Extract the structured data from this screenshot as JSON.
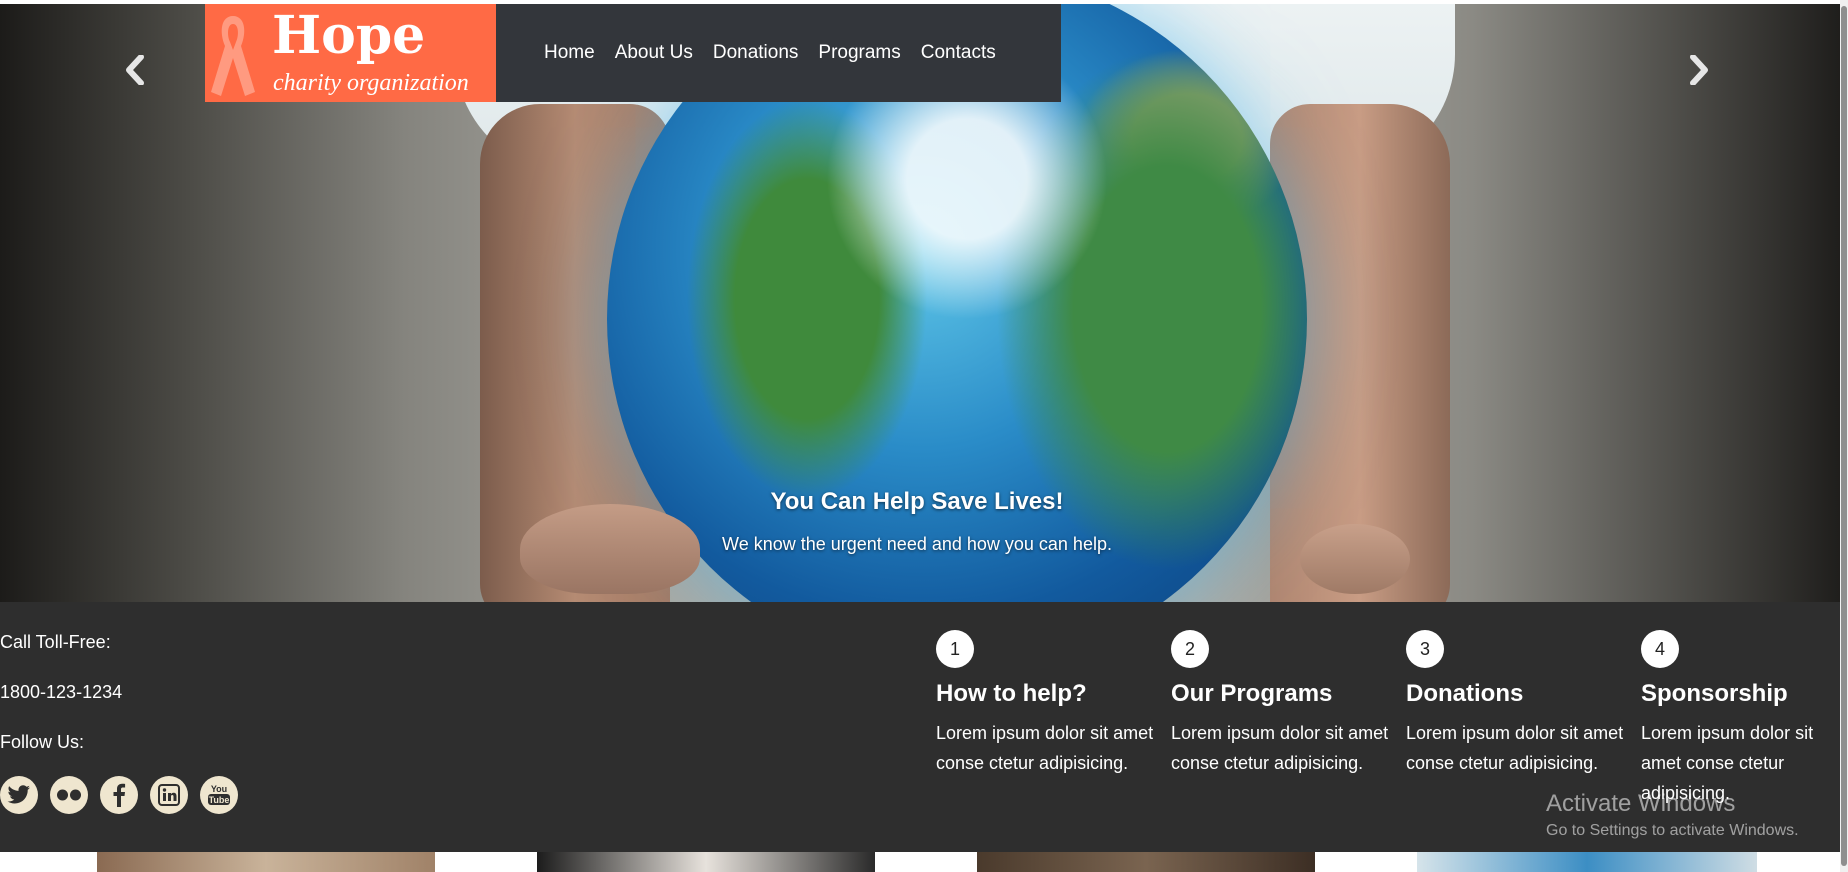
{
  "brand": {
    "name": "Hope",
    "tagline": "charity organization",
    "color": "#ff6a45"
  },
  "nav": {
    "items": [
      {
        "label": "Home"
      },
      {
        "label": "About Us"
      },
      {
        "label": "Donations"
      },
      {
        "label": "Programs"
      },
      {
        "label": "Contacts"
      }
    ]
  },
  "hero": {
    "title": "You Can Help Save Lives!",
    "subtitle": "We know the urgent need and how you can help.",
    "prev_icon": "chevron-left",
    "next_icon": "chevron-right"
  },
  "contact": {
    "toll_free_label": "Call Toll-Free:",
    "phone": "1800-123-1234",
    "follow_label": "Follow Us:",
    "social": [
      {
        "name": "twitter-icon"
      },
      {
        "name": "flickr-icon"
      },
      {
        "name": "facebook-icon"
      },
      {
        "name": "linkedin-icon"
      },
      {
        "name": "youtube-icon"
      }
    ]
  },
  "features": [
    {
      "num": "1",
      "title": "How to help?",
      "text": "Lorem ipsum dolor sit amet conse ctetur adipisicing."
    },
    {
      "num": "2",
      "title": "Our Programs",
      "text": "Lorem ipsum dolor sit amet conse ctetur adipisicing."
    },
    {
      "num": "3",
      "title": "Donations",
      "text": "Lorem ipsum dolor sit amet conse ctetur adipisicing."
    },
    {
      "num": "4",
      "title": "Sponsorship",
      "text": "Lorem ipsum dolor sit amet conse ctetur adipisicing."
    }
  ],
  "watermark": {
    "line1": "Activate Windows",
    "line2": "Go to Settings to activate Windows."
  },
  "colors": {
    "band_bg": "#2e2e2e",
    "nav_bg": "#33363b",
    "social_bg": "#efe6cf"
  }
}
